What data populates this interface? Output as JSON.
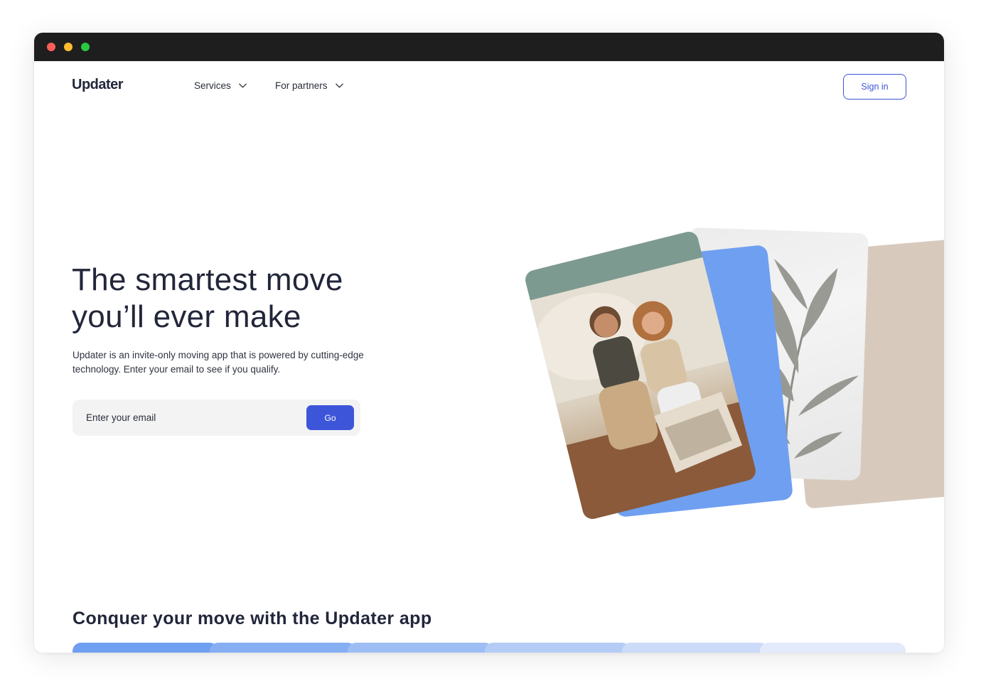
{
  "header": {
    "logo": "Updater",
    "nav": [
      {
        "label": "Services"
      },
      {
        "label": "For partners"
      }
    ],
    "signin_label": "Sign in"
  },
  "hero": {
    "title": "The smartest move you’ll ever make",
    "subtitle": "Updater is an invite-only moving app that is powered by cutting-edge technology. Enter your email to see if you qualify.",
    "email_placeholder": "Enter your email",
    "email_value": "",
    "go_label": "Go"
  },
  "collage": {
    "icons": [
      "couple-unpacking-photo",
      "blue-card",
      "plant-shadow-photo",
      "tan-card"
    ]
  },
  "section": {
    "title": "Conquer your move with the Updater app"
  },
  "colors": {
    "accent": "#3d55d8",
    "card_blue": "#6f9ff0",
    "card_tan": "#d7cabd",
    "text_dark": "#22263a",
    "input_bg": "#f3f3f4",
    "tab_gradient": [
      "#6f9ff0",
      "#86aef2",
      "#9dbdf4",
      "#b4ccf6",
      "#cbdbf8",
      "#e2eafb"
    ]
  }
}
